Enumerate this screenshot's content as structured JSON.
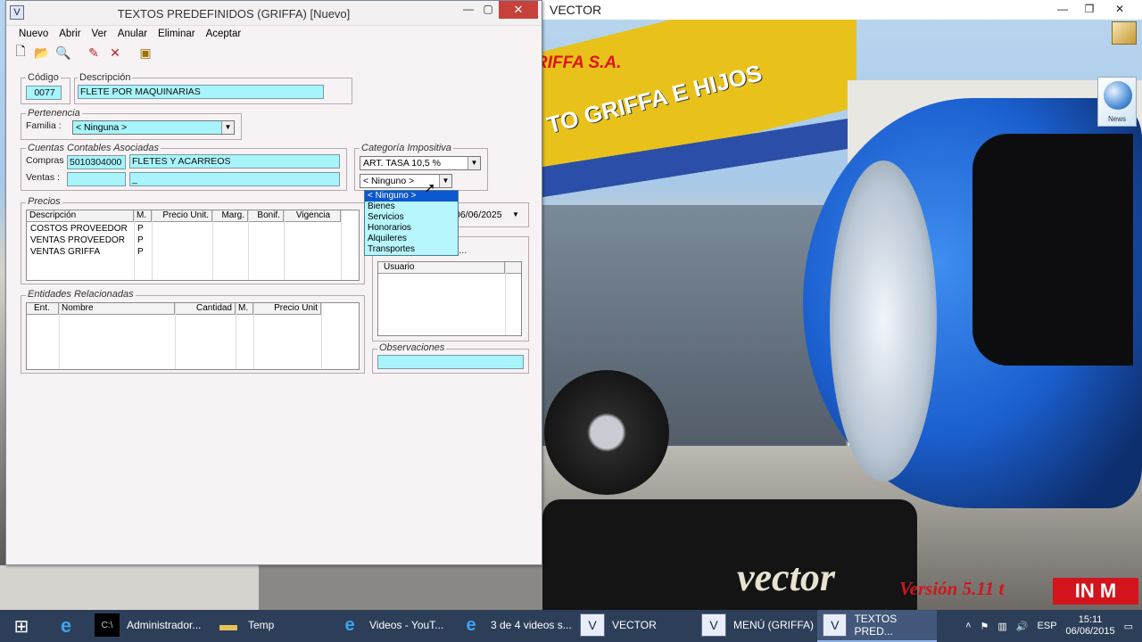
{
  "desktop": {
    "app_title": "VECTOR",
    "brand_top": "RIFFA S.A.",
    "building_sign": "TO GRIFFA E HIJOS",
    "vector_logo": "vector",
    "version": "Versión 5.11 t",
    "news_label": "News",
    "company_logo": "IN M"
  },
  "window": {
    "title": "TEXTOS PREDEFINIDOS (GRIFFA)  [Nuevo]",
    "menu": [
      "Nuevo",
      "Abrir",
      "Ver",
      "Anular",
      "Eliminar",
      "Aceptar"
    ],
    "toolbar_icons": [
      "new-document-icon",
      "open-folder-icon",
      "search-icon",
      "edit-icon",
      "delete-icon",
      "exit-icon"
    ]
  },
  "form": {
    "codigo_label": "Código",
    "codigo_value": "0077",
    "descripcion_label": "Descripción",
    "descripcion_value": "FLETE POR MAQUINARIAS",
    "pertenencia_label": "Pertenencia",
    "familia_label": "Familia :",
    "familia_value": "< Ninguna >",
    "cuentas_label": "Cuentas Contables Asociadas",
    "compras_label": "Compras :",
    "compras_code": "5010304000",
    "compras_desc": "FLETES Y ACARREOS",
    "ventas_label": "Ventas :",
    "ventas_code": "",
    "ventas_desc": "_",
    "categoria_label": "Categoría Impositiva",
    "categoria_value": "ART. TASA 10,5 %",
    "categoria2_value": "< Ninguno >",
    "dropdown_options": [
      "< Ninguno >",
      "Bienes",
      "Servicios",
      "Honorarios",
      "Alquileres",
      "Transportes"
    ],
    "precios_label": "Precios",
    "precios_columns": [
      "Descripción",
      "M.",
      "Precio Unit.",
      "Marg.",
      "Bonif.",
      "Vigencia"
    ],
    "precios_rows": [
      {
        "desc": "COSTOS PROVEEDOR",
        "m": "P"
      },
      {
        "desc": "VENTAS PROVEEDOR",
        "m": "P"
      },
      {
        "desc": "VENTAS GRIFFA",
        "m": "P"
      }
    ],
    "date_value": "06/06/2025",
    "hidden_group_label": "a ...",
    "usuario_column": "Usuario",
    "entidades_label": "Entidades Relacionadas",
    "entidades_columns": [
      "Ent.",
      "Nombre",
      "Cantidad",
      "M.",
      "Precio Unit"
    ],
    "observaciones_label": "Observaciones",
    "observaciones_value": ""
  },
  "taskbar": {
    "items": [
      {
        "label": "Administrador...",
        "icon": "cmd-icon"
      },
      {
        "label": "Temp",
        "icon": "folder-icon"
      },
      {
        "label": "Videos - YouT...",
        "icon": "ie-icon"
      },
      {
        "label": "3 de 4 videos s...",
        "icon": "ie-icon"
      },
      {
        "label": "VECTOR",
        "icon": "vector-icon"
      },
      {
        "label": "MENÚ (GRIFFA)",
        "icon": "vector-icon"
      },
      {
        "label": "TEXTOS PRED...",
        "icon": "vector-icon"
      }
    ],
    "lang": "ESP",
    "time": "15:11",
    "date": "06/06/2015"
  }
}
